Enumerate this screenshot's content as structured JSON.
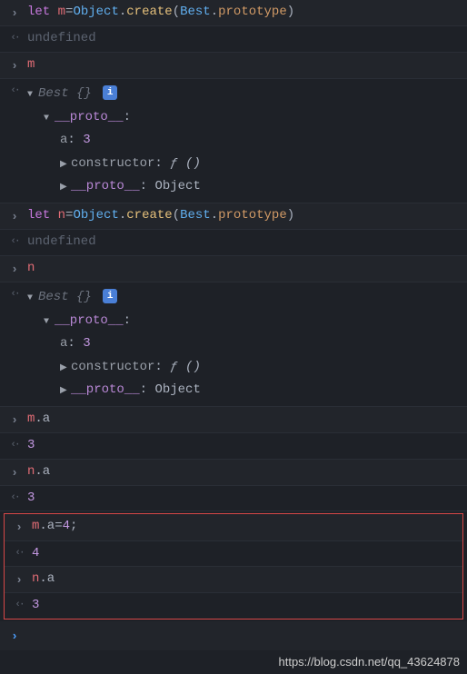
{
  "lines": {
    "l1_let": "let",
    "l1_var": " m",
    "l1_eq": "=",
    "l1_obj": "Object",
    "l1_dot": ".",
    "l1_create": "create",
    "l1_open": "(",
    "l1_best": "Best",
    "l1_proto": "prototype",
    "l1_close": ")",
    "undef": "undefined",
    "m": "m",
    "best_label": "Best ",
    "best_braces": "{}",
    "proto_key": "__proto__",
    "a_key": "a",
    "a_val": "3",
    "ctor_key": "constructor",
    "ctor_val": "ƒ ()",
    "obj_val": "Object",
    "l2_var": " n",
    "n": "n",
    "ma": "m",
    "na": "n",
    "dot_a": ".a",
    "val3": "3",
    "ma_assign_lhs": "m",
    "ma_assign_mid": ".a=",
    "ma_assign_val": "4",
    "ma_assign_semi": ";",
    "out4": "4",
    "na2": "n",
    "out3b": "3"
  },
  "info_icon": "i",
  "watermark": "https://blog.csdn.net/qq_43624878"
}
